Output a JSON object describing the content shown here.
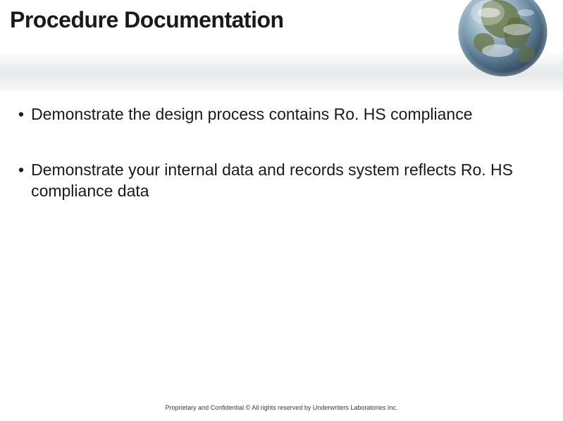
{
  "slide": {
    "title": "Procedure Documentation",
    "bullets": [
      "Demonstrate the design process contains Ro. HS compliance",
      "Demonstrate your internal data and records system reflects Ro. HS compliance data"
    ],
    "footer": "Proprietary and Confidential © All rights reserved by Underwriters Laboratories Inc.",
    "globe_alt": "earth-globe"
  }
}
